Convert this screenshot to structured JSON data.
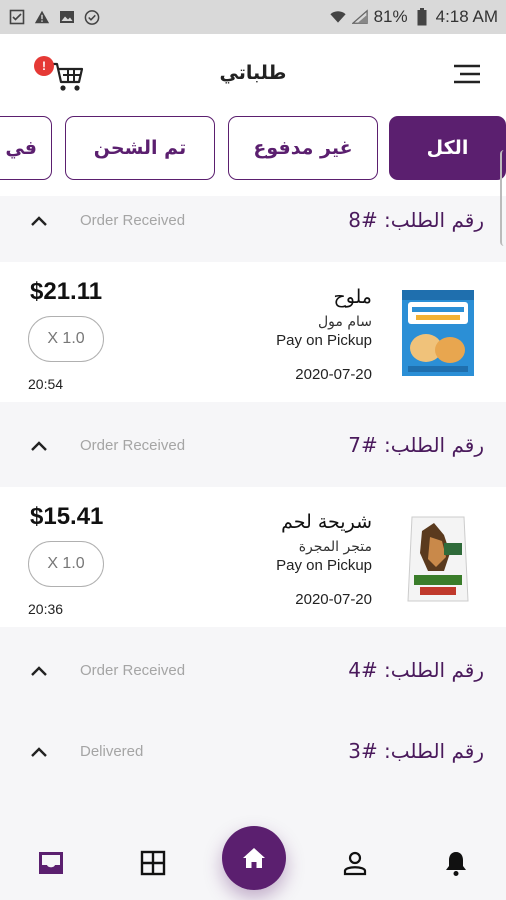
{
  "status_bar": {
    "battery": "81%",
    "time": "4:18 AM",
    "icons": [
      "checklist-icon",
      "warning-icon",
      "image-icon",
      "check-circle-icon",
      "wifi-icon",
      "signal-icon",
      "battery-icon"
    ]
  },
  "header": {
    "title": "طلباتي",
    "cart_badge": "!",
    "icons": [
      "cart-icon",
      "menu-icon"
    ]
  },
  "tabs": [
    {
      "label": "الكل",
      "active": true
    },
    {
      "label": "غير مدفوع",
      "active": false
    },
    {
      "label": "تم الشحن",
      "active": false
    },
    {
      "label": "في",
      "active": false
    }
  ],
  "orders": [
    {
      "number": "رقم الطلب: #8",
      "status": "Order Received",
      "expanded": true,
      "item": {
        "price": "$21.11",
        "quantity": "X 1.0",
        "time": "20:54",
        "name": "ملوح",
        "store": "سام مول",
        "payment": "Pay on Pickup",
        "date": "2020-07-20",
        "image": "rusks-box-image"
      }
    },
    {
      "number": "رقم الطلب: #7",
      "status": "Order Received",
      "expanded": true,
      "item": {
        "price": "$15.41",
        "quantity": "X 1.0",
        "time": "20:36",
        "name": "شريحة لحم",
        "store": "متجر المجرة",
        "payment": "Pay on Pickup",
        "date": "2020-07-20",
        "image": "dog-food-bag-image"
      }
    },
    {
      "number": "رقم الطلب: #4",
      "status": "Order Received",
      "expanded": false
    },
    {
      "number": "رقم الطلب: #3",
      "status": "Delivered",
      "expanded": false
    }
  ],
  "bottom_nav": {
    "items": [
      "inbox-icon",
      "grid-icon",
      "home-icon",
      "user-icon",
      "bell-icon"
    ]
  },
  "colors": {
    "primary": "#5b1f6f",
    "order_number": "#4a1a5c",
    "status_gray": "#a5a5a5",
    "badge_red": "#e53935",
    "background": "#f6f6f8"
  }
}
